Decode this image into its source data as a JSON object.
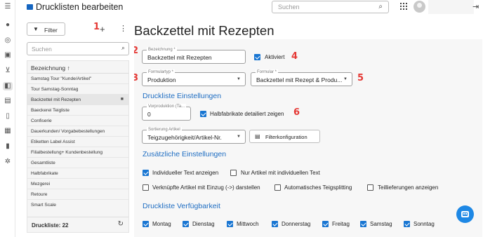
{
  "header": {
    "title": "Drucklisten bearbeiten",
    "search_placeholder": "Suchen"
  },
  "nav_icons": [
    "menu-icon",
    "user-icon",
    "target-icon",
    "box-icon",
    "cart-icon",
    "bakery-icon",
    "cash-icon",
    "phone-icon",
    "calendar-icon",
    "chart-icon",
    "settings-icon"
  ],
  "left": {
    "filter_label": "Filter",
    "search_placeholder": "Suchen",
    "column_header": "Bezeichnung",
    "sort_icon": "↑",
    "items": [
      "Samstag Tour \"Kunde/Artikel\"",
      "Tour Samstag-Sonntag",
      "Backzettel mit Rezepten",
      "Baeckerei Teigliste",
      "Confiserie",
      "Dauerkunden/ Vorgabebestellungen",
      "Etiketten Label Assist",
      "Filialbestellung+ Kundenbestellung",
      "Gesamtliste",
      "Halbfabrikate",
      "Mezgerei",
      "Retoure",
      "Smart Scale"
    ],
    "selected_index": 2,
    "footer": "Druckliste: 22"
  },
  "annotations": [
    "1",
    "2",
    "3",
    "4",
    "5",
    "6"
  ],
  "form": {
    "title": "Backzettel mit Rezepten",
    "bezeichnung_label": "Bezeichnung *",
    "bezeichnung_value": "Backzettel mit Rezepten",
    "aktiviert_label": "Aktiviert",
    "formulartyp_label": "Formulartyp *",
    "formulartyp_value": "Produktion",
    "formular_label": "Formular *",
    "formular_value": "Backzettel mit Rezept & Produ...",
    "section1": "Druckliste Einstellungen",
    "vorproduktion_label": "Vorproduktion (Ta...",
    "vorproduktion_value": "0",
    "halbfabrikate_label": "Halbfabrikate detailiert zeigen",
    "sortierung_label": "Sortierung Artikel",
    "sortierung_value": "Teigzugehörigkeit/Artikel-Nr.",
    "filter_button": "Filterkonfiguration",
    "section2": "Zusätzliche Einstellungen",
    "opt_individuell": "Individueller Text anzeigen",
    "opt_nur_artikel": "Nur Artikel mit individuellen Text",
    "opt_verknuepft": "Verknüpfte Artikel mit Einzug (->) darstellen",
    "opt_teigsplitting": "Automatisches Teigsplitting",
    "opt_teillieferungen": "Teillieferungen anzeigen",
    "section3": "Druckliste Verfügbarkeit",
    "days": [
      "Montag",
      "Dienstag",
      "Mittwoch",
      "Donnerstag",
      "Freitag",
      "Samstag",
      "Sonntag"
    ]
  }
}
